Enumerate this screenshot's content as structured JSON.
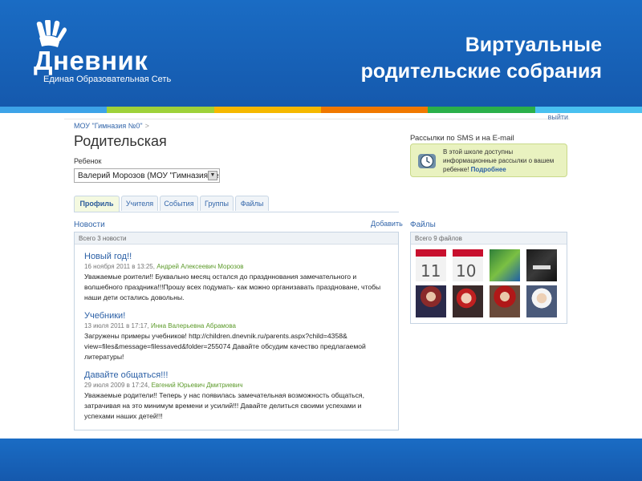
{
  "slide": {
    "title_line1": "Виртуальные",
    "title_line2": "родительские собрания",
    "logo_name": "Дневник",
    "logo_subtitle": "Единая Образовательная Сеть",
    "colors": {
      "header": "#1a6cc4",
      "stripe": [
        "#3da3e8",
        "#9ed13a",
        "#f5b800",
        "#f07800",
        "#2bb04a",
        "#49c0f0"
      ]
    }
  },
  "page": {
    "top_link": "выйти",
    "breadcrumb": "МОУ \"Гимназия №0\"",
    "breadcrumb_sep": ">",
    "title": "Родительская",
    "child_label": "Ребенок",
    "child_value": "Валерий Морозов (МОУ \"Гимназия №0\")",
    "tabs": [
      {
        "label": "Профиль",
        "active": true
      },
      {
        "label": "Учителя",
        "active": false
      },
      {
        "label": "События",
        "active": false
      },
      {
        "label": "Группы",
        "active": false
      },
      {
        "label": "Файлы",
        "active": false
      }
    ],
    "news": {
      "title": "Новости",
      "add_label": "Добавить",
      "total": "Всего 3 новости",
      "items": [
        {
          "title": "Новый год!!",
          "date": "16 ноября 2011 в 13:25,",
          "author": "Андрей Алексеевич Морозов",
          "text": "Уважаемые роители!! Буквально месяц остался до праздннования замечательного и волшебного праздника!!!Прошу всех подумать- как можно организавать праздноване, чтобы наши дети остались довольны."
        },
        {
          "title": "Учебники!",
          "date": "13 июля 2011 в 17:17,",
          "author": "Инна Валерьевна Абрамова",
          "text": "Загружены примеры учебников! http://children.dnevnik.ru/parents.aspx?child=4358& view=files&message=filessaved&folder=255074 Давайте обсудим качество предлагаемой литературы!"
        },
        {
          "title": "Давайте общаться!!!",
          "date": "29 июля 2009 в 17:24,",
          "author": "Евгений Юрьевич Дмитриевич",
          "text": "Уважаемые родители!! Теперь у нас появилась замечательная возможность общаться, затрачивая на это минимум времени и усилий!!! Давайте делиться своими успехами и успехами наших детей!!!"
        }
      ]
    },
    "sms": {
      "title": "Рассылки по SMS и на E-mail",
      "text": "В этой школе доступны информационные рассылки о вашем ребенке!",
      "more": "Подробнее"
    },
    "files": {
      "title": "Файлы",
      "total": "Всего 9 файлов"
    }
  }
}
